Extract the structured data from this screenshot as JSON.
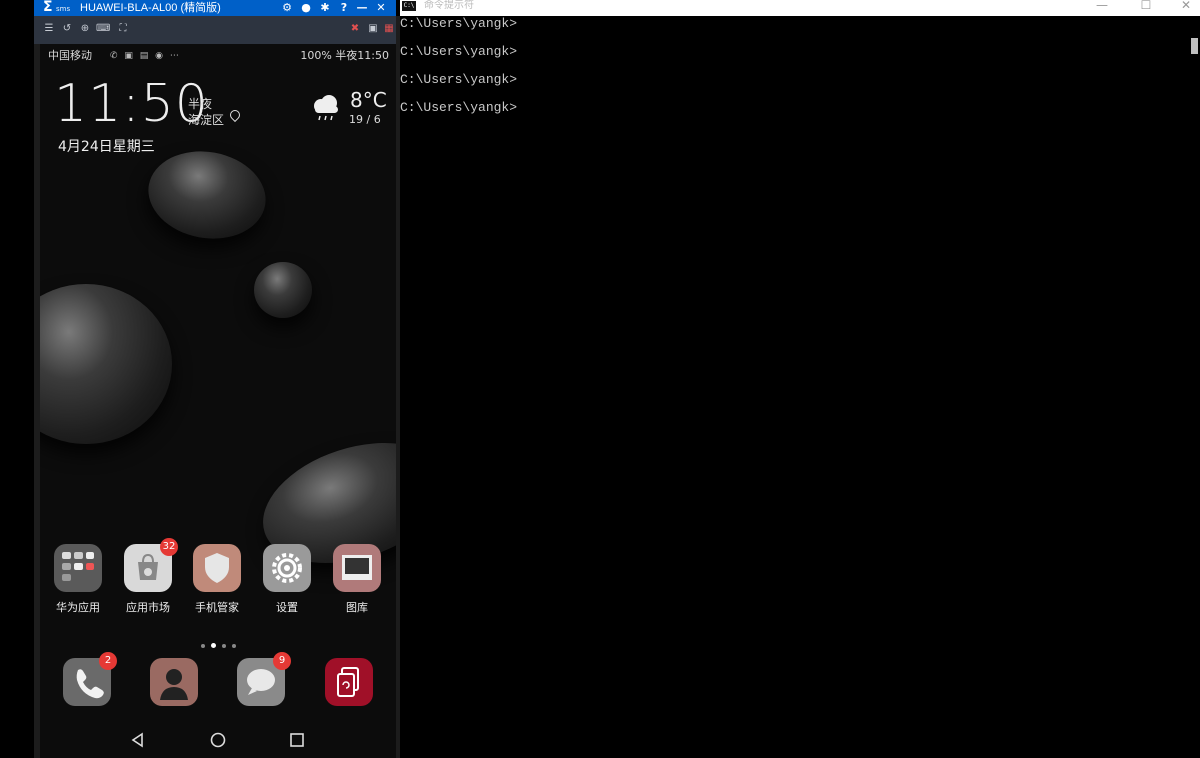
{
  "mirror": {
    "title": "HUAWEI-BLA-AL00 (精简版)",
    "logo_text": "sms",
    "title_buttons": [
      "settings-icon",
      "info-icon",
      "pin-icon",
      "help-icon",
      "minimize-icon",
      "close-icon"
    ],
    "toolbar_icons": [
      "menu-icon",
      "rotate-icon",
      "zoom-icon",
      "keyboard-icon",
      "fullscreen-icon",
      "mute-icon",
      "screen-icon",
      "grid-icon"
    ]
  },
  "phone": {
    "status": {
      "carrier": "中国移动",
      "right": "100%  半夜11:50"
    },
    "clock": {
      "time": "11:50",
      "ampm": "半夜",
      "location": "海淀区"
    },
    "date": "4月24日星期三",
    "weather": {
      "temp": "8°C",
      "range": "19 / 6",
      "icon": "cloud-rain-icon"
    },
    "apps": [
      {
        "label": "华为应用",
        "badge": ""
      },
      {
        "label": "应用市场",
        "badge": "32"
      },
      {
        "label": "手机管家",
        "badge": ""
      },
      {
        "label": "设置",
        "badge": ""
      },
      {
        "label": "图库",
        "badge": ""
      }
    ],
    "dock": [
      {
        "name": "phone",
        "badge": "2"
      },
      {
        "name": "contacts",
        "badge": ""
      },
      {
        "name": "messages",
        "badge": "9"
      },
      {
        "name": "mirror-app",
        "badge": ""
      }
    ],
    "page_dots": 4,
    "active_page": 2
  },
  "cmd": {
    "title": "命令提示符",
    "lines": [
      "C:\\Users\\yangk>",
      "C:\\Users\\yangk>",
      "C:\\Users\\yangk>",
      "C:\\Users\\yangk>"
    ]
  },
  "colors": {
    "mirror_title_bg": "#0060c8",
    "badge": "#e53935"
  }
}
